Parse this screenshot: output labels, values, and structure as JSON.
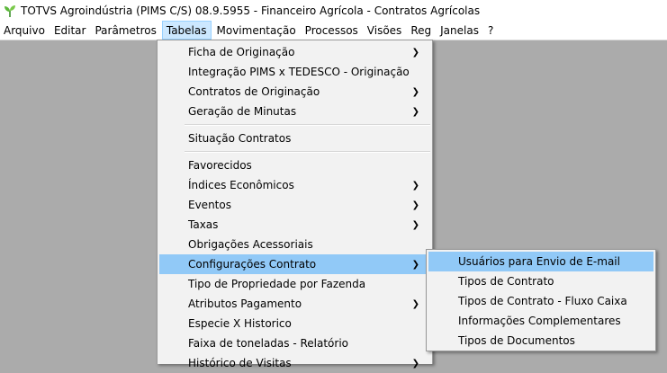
{
  "window": {
    "title": "TOTVS Agroindústria (PIMS C/S) 08.9.5955 - Financeiro Agrícola - Contratos Agrícolas"
  },
  "menubar": {
    "items": [
      "Arquivo",
      "Editar",
      "Parâmetros",
      "Tabelas",
      "Movimentação",
      "Processos",
      "Visões",
      "Reg",
      "Janelas",
      "?"
    ],
    "active": "Tabelas"
  },
  "tabelas_menu": {
    "items": [
      {
        "label": "Ficha de Originação",
        "submenu": true
      },
      {
        "label": "Integração PIMS x TEDESCO - Originação",
        "submenu": false
      },
      {
        "label": "Contratos de Originação",
        "submenu": true
      },
      {
        "label": "Geração de Minutas",
        "submenu": true
      },
      {
        "label": "Situação Contratos",
        "submenu": false
      },
      {
        "label": "Favorecidos",
        "submenu": false
      },
      {
        "label": "Índices Econômicos",
        "submenu": true
      },
      {
        "label": "Eventos",
        "submenu": true
      },
      {
        "label": "Taxas",
        "submenu": true
      },
      {
        "label": "Obrigações Acessoriais",
        "submenu": false
      },
      {
        "label": "Configurações Contrato",
        "submenu": true,
        "highlighted": true
      },
      {
        "label": "Tipo de Propriedade por Fazenda",
        "submenu": false
      },
      {
        "label": "Atributos Pagamento",
        "submenu": true
      },
      {
        "label": "Especie X Historico",
        "submenu": false
      },
      {
        "label": "Faixa de toneladas - Relatório",
        "submenu": false
      },
      {
        "label": "Histórico de Visitas",
        "submenu": true
      }
    ]
  },
  "config_submenu": {
    "items": [
      {
        "label": "Usuários para Envio de E-mail",
        "highlighted": true
      },
      {
        "label": "Tipos de Contrato"
      },
      {
        "label": "Tipos de Contrato - Fluxo Caixa"
      },
      {
        "label": "Informações Complementares"
      },
      {
        "label": "Tipos de Documentos"
      }
    ]
  },
  "colors": {
    "highlight": "#91c9f7",
    "workspace": "#ababab",
    "menu_bg": "#f2f2f2"
  },
  "icons": {
    "app": "sprout-icon",
    "submenu": "chevron-right-icon"
  }
}
